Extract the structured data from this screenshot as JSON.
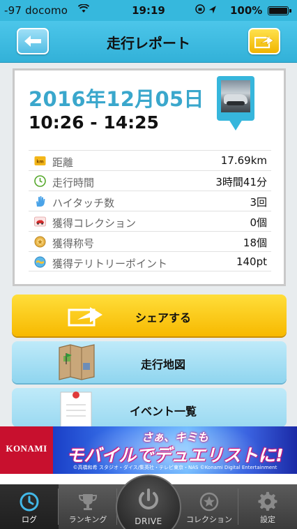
{
  "status_bar": {
    "carrier": "-97 docomo",
    "time": "19:19",
    "battery": "100%"
  },
  "nav": {
    "title": "走行レポート",
    "back_icon": "arrow-left-icon",
    "share_icon": "share-arrow-icon"
  },
  "report": {
    "date": "2016年12月05日",
    "time_range": "10:26 - 14:25",
    "stats": [
      {
        "icon": "km-icon",
        "label": "距離",
        "value": "17.69km"
      },
      {
        "icon": "clock-icon",
        "label": "走行時間",
        "value": "3時間41分"
      },
      {
        "icon": "hand-icon",
        "label": "ハイタッチ数",
        "value": "3回"
      },
      {
        "icon": "car-icon",
        "label": "獲得コレクション",
        "value": "0個"
      },
      {
        "icon": "medal-icon",
        "label": "獲得称号",
        "value": "18個"
      },
      {
        "icon": "globe-icon",
        "label": "獲得テリトリーポイント",
        "value": "140pt"
      }
    ]
  },
  "actions": {
    "share": "シェアする",
    "map": "走行地図",
    "events": "イベント一覧"
  },
  "ad": {
    "brand": "KONAMI",
    "line1": "さぁ、キミも",
    "line2": "モバイルでデュエリストに!",
    "copyright": "©高橋和希 スタジオ・ダイス/集英社・テレビ東京・NAS ©Konami Digital Entertainment"
  },
  "tabs": [
    {
      "label": "ログ",
      "icon": "clock-icon"
    },
    {
      "label": "ランキング",
      "icon": "trophy-icon"
    },
    {
      "label": "DRIVE",
      "icon": "power-icon"
    },
    {
      "label": "コレクション",
      "icon": "star-icon"
    },
    {
      "label": "設定",
      "icon": "gear-icon"
    }
  ],
  "colors": {
    "header": "#36b8dd",
    "date_text": "#3aa7cc",
    "share_button": "#f7b900",
    "secondary_button": "#9ad9f1",
    "tab_bar": "#3b3b3b"
  }
}
